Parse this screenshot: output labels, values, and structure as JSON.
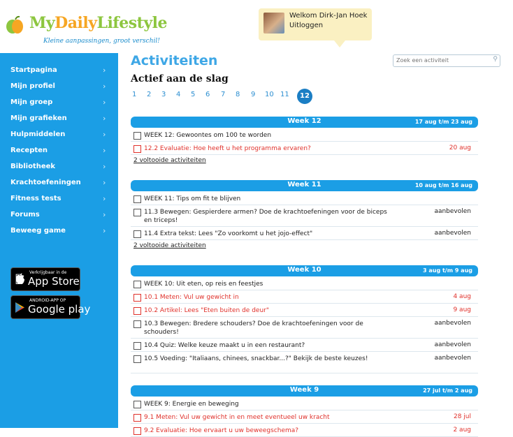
{
  "header": {
    "brand_my": "My",
    "brand_daily": "Daily",
    "brand_lifestyle": "Lifestyle",
    "tagline": "Kleine aanpassingen, groot verschil!",
    "welcome": "Welkom Dirk-Jan Hoek",
    "logout": "Uitloggen"
  },
  "sidebar": {
    "items": [
      {
        "label": "Startpagina"
      },
      {
        "label": "Mijn profiel"
      },
      {
        "label": "Mijn groep"
      },
      {
        "label": "Mijn grafieken"
      },
      {
        "label": "Hulpmiddelen"
      },
      {
        "label": "Recepten"
      },
      {
        "label": "Bibliotheek"
      },
      {
        "label": "Krachtoefeningen"
      },
      {
        "label": "Fitness tests"
      },
      {
        "label": "Forums"
      },
      {
        "label": "Beweeg game"
      }
    ],
    "chevron": "›",
    "appstore": {
      "small": "Verkrijgbaar in de",
      "big": "App Store"
    },
    "googleplay": {
      "small": "ANDROID-APP OP",
      "big": "Google play"
    }
  },
  "main": {
    "title": "Activiteiten",
    "search_placeholder": "Zoek een activiteit",
    "subtitle": "Actief aan de slag",
    "pages": [
      "1",
      "2",
      "3",
      "4",
      "5",
      "6",
      "7",
      "8",
      "9",
      "10",
      "11",
      "12"
    ],
    "current_page": "12",
    "weeks": [
      {
        "title": "Week 12",
        "range": "17 aug t/m 23 aug",
        "rows": [
          {
            "text": "WEEK 12: Gewoontes om 100 te worden",
            "status": "",
            "red": false
          },
          {
            "text": "12.2 Evaluatie: Hoe heeft u het programma ervaren?",
            "status": "20 aug",
            "red": true
          }
        ],
        "completed": "2 voltooide activiteiten"
      },
      {
        "title": "Week 11",
        "range": "10 aug t/m 16 aug",
        "rows": [
          {
            "text": "WEEK 11: Tips om fit te blijven",
            "status": "",
            "red": false
          },
          {
            "text": "11.3 Bewegen: Gespierdere armen? Doe de krachtoefeningen voor de biceps en triceps!",
            "status": "aanbevolen",
            "red": false
          },
          {
            "text": "11.4 Extra tekst: Lees \"Zo voorkomt u het jojo-effect\"",
            "status": "aanbevolen",
            "red": false
          }
        ],
        "completed": "2 voltooide activiteiten"
      },
      {
        "title": "Week 10",
        "range": "3 aug t/m 9 aug",
        "rows": [
          {
            "text": "WEEK 10: Uit eten, op reis en feestjes",
            "status": "",
            "red": false
          },
          {
            "text": "10.1 Meten: Vul uw gewicht in",
            "status": "4 aug",
            "red": true
          },
          {
            "text": "10.2 Artikel: Lees \"Eten buiten de deur\"",
            "status": "9 aug",
            "red": true
          },
          {
            "text": "10.3 Bewegen: Bredere schouders? Doe de krachtoefeningen voor de schouders!",
            "status": "aanbevolen",
            "red": false
          },
          {
            "text": "10.4 Quiz: Welke keuze maakt u in een restaurant?",
            "status": "aanbevolen",
            "red": false
          },
          {
            "text": "10.5 Voeding: \"Italiaans, chinees, snackbar...?\" Bekijk de beste keuzes!",
            "status": "aanbevolen",
            "red": false
          }
        ]
      },
      {
        "title": "Week 9",
        "range": "27 jul t/m 2 aug",
        "rows": [
          {
            "text": "WEEK 9: Energie en beweging",
            "status": "",
            "red": false
          },
          {
            "text": "9.1 Meten: Vul uw gewicht in en meet eventueel uw kracht",
            "status": "28 jul",
            "red": true
          },
          {
            "text": "9.2 Evaluatie: Hoe ervaart u uw beweegschema?",
            "status": "2 aug",
            "red": true
          }
        ]
      }
    ]
  },
  "colors": {
    "sidebar": "#1b9ee5",
    "accent": "#3ea7e6",
    "overdue": "#e0312b",
    "user_box": "#faf0c2"
  }
}
